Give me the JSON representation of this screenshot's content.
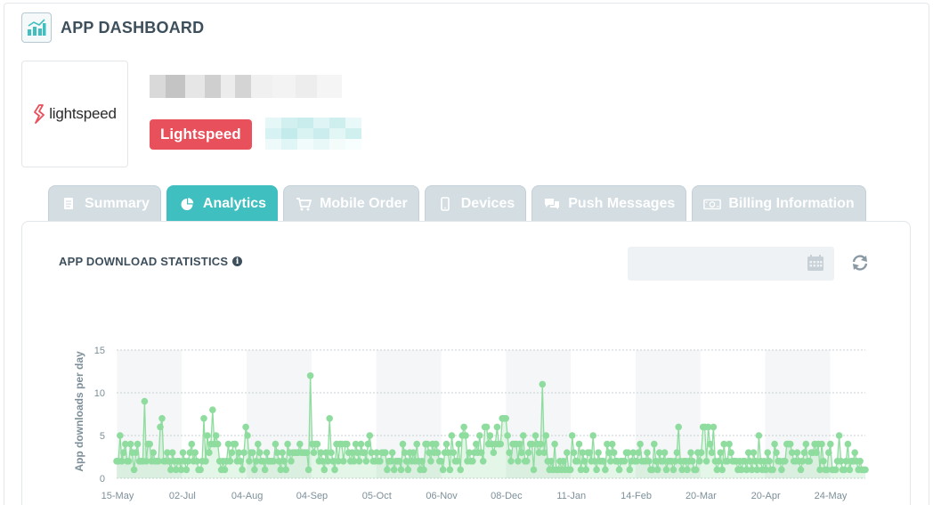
{
  "header": {
    "title": "APP DASHBOARD",
    "icon": "chart-bars-icon"
  },
  "app": {
    "logo_text": "lightspeed",
    "badge_label": "Lightspeed",
    "badge_color": "#e8505b"
  },
  "tabs": [
    {
      "label": "Summary",
      "icon": "document-icon",
      "active": false
    },
    {
      "label": "Analytics",
      "icon": "pie-chart-icon",
      "active": true
    },
    {
      "label": "Mobile Order",
      "icon": "cart-icon",
      "active": false
    },
    {
      "label": "Devices",
      "icon": "phone-icon",
      "active": false
    },
    {
      "label": "Push Messages",
      "icon": "chat-icon",
      "active": false
    },
    {
      "label": "Billing Information",
      "icon": "money-icon",
      "active": false
    }
  ],
  "stats": {
    "title": "APP DOWNLOAD STATISTICS",
    "date_value": ""
  },
  "colors": {
    "accent": "#3fbfbf",
    "series": "#8fdc9f"
  },
  "chart_data": {
    "type": "line",
    "title": "",
    "ylabel": "App downloads per day",
    "xlabel": "",
    "ylim": [
      0,
      15
    ],
    "yticks": [
      0,
      5,
      10,
      15
    ],
    "xticks": [
      "15-May",
      "02-Jul",
      "04-Aug",
      "04-Sep",
      "05-Oct",
      "06-Nov",
      "08-Dec",
      "11-Jan",
      "14-Feb",
      "20-Mar",
      "20-Apr",
      "24-May"
    ],
    "grid": true,
    "series": [
      {
        "name": "",
        "values": [
          2,
          2,
          5,
          2,
          3,
          4,
          2,
          2,
          4,
          3,
          1,
          3,
          4,
          2,
          2,
          2,
          9,
          2,
          4,
          4,
          2,
          3,
          2,
          2,
          2,
          6,
          7,
          2,
          2,
          3,
          2,
          1,
          3,
          2,
          1,
          2,
          2,
          1,
          3,
          2,
          1,
          2,
          3,
          4,
          2,
          3,
          2,
          1,
          1,
          2,
          7,
          2,
          5,
          3,
          4,
          8,
          4,
          5,
          4,
          2,
          1,
          2,
          1,
          2,
          4,
          2,
          3,
          4,
          4,
          2,
          3,
          2,
          1,
          3,
          6,
          5,
          2,
          3,
          3,
          1,
          2,
          4,
          3,
          2,
          2,
          1,
          3,
          2,
          2,
          2,
          2,
          4,
          3,
          2,
          1,
          3,
          2,
          1,
          4,
          3,
          2,
          3,
          3,
          3,
          3,
          4,
          3,
          3,
          3,
          3,
          1,
          12,
          4,
          3,
          4,
          4,
          2,
          3,
          2,
          1,
          3,
          2,
          7,
          3,
          2,
          1,
          4,
          2,
          4,
          4,
          2,
          4,
          4,
          3,
          2,
          3,
          2,
          4,
          3,
          2,
          4,
          3,
          3,
          2,
          4,
          5,
          3,
          2,
          2,
          3,
          2,
          2,
          3,
          3,
          3,
          1,
          2,
          2,
          3,
          1,
          2,
          2,
          2,
          1,
          4,
          3,
          2,
          1,
          3,
          2,
          3,
          2,
          4,
          2,
          1,
          2,
          1,
          4,
          4,
          3,
          2,
          4,
          3,
          4,
          3,
          2,
          2,
          1,
          3,
          4,
          3,
          1,
          5,
          3,
          2,
          2,
          4,
          1,
          5,
          6,
          5,
          2,
          3,
          2,
          2,
          3,
          4,
          3,
          5,
          3,
          2,
          6,
          6,
          4,
          5,
          4,
          3,
          4,
          6,
          4,
          4,
          7,
          7,
          7,
          5,
          3,
          2,
          4,
          4,
          4,
          2,
          4,
          3,
          5,
          2,
          2,
          3,
          4,
          4,
          1,
          5,
          4,
          3,
          4,
          11,
          3,
          5,
          2,
          1,
          2,
          1,
          4,
          1,
          1,
          2,
          1,
          2,
          1,
          3,
          1,
          1,
          5,
          3,
          2,
          2,
          4,
          1,
          3,
          2,
          1,
          3,
          3,
          2,
          5,
          2,
          1,
          3,
          2,
          2,
          2,
          1,
          4,
          3,
          2,
          4,
          3,
          2,
          2,
          1,
          2,
          2,
          2,
          3,
          3,
          1,
          2,
          3,
          2,
          2,
          3,
          4,
          2,
          2,
          2,
          3,
          2,
          1,
          1,
          4,
          2,
          1,
          3,
          2,
          2,
          3,
          1,
          2,
          2,
          2,
          1,
          2,
          3,
          6,
          2,
          1,
          2,
          2,
          1,
          2,
          3,
          2,
          1,
          1,
          3,
          2,
          3,
          6,
          6,
          2,
          6,
          4,
          3,
          6,
          2,
          1,
          2,
          3,
          1,
          4,
          2,
          2,
          4,
          3,
          2,
          2,
          2,
          1,
          2,
          1,
          2,
          2,
          1,
          3,
          2,
          1,
          3,
          2,
          1,
          5,
          2,
          1,
          2,
          1,
          3,
          2,
          1,
          1,
          4,
          3,
          2,
          2,
          1,
          2,
          2,
          4,
          4,
          4,
          3,
          2,
          2,
          3,
          2,
          1,
          2,
          3,
          4,
          2,
          2,
          3,
          3,
          4,
          3,
          4,
          1,
          4,
          2,
          1,
          1,
          3,
          4,
          1,
          1,
          1,
          2,
          5,
          2,
          1,
          1,
          2,
          4,
          1,
          2,
          2,
          3,
          2,
          1,
          2,
          1,
          1,
          1
        ]
      }
    ]
  }
}
